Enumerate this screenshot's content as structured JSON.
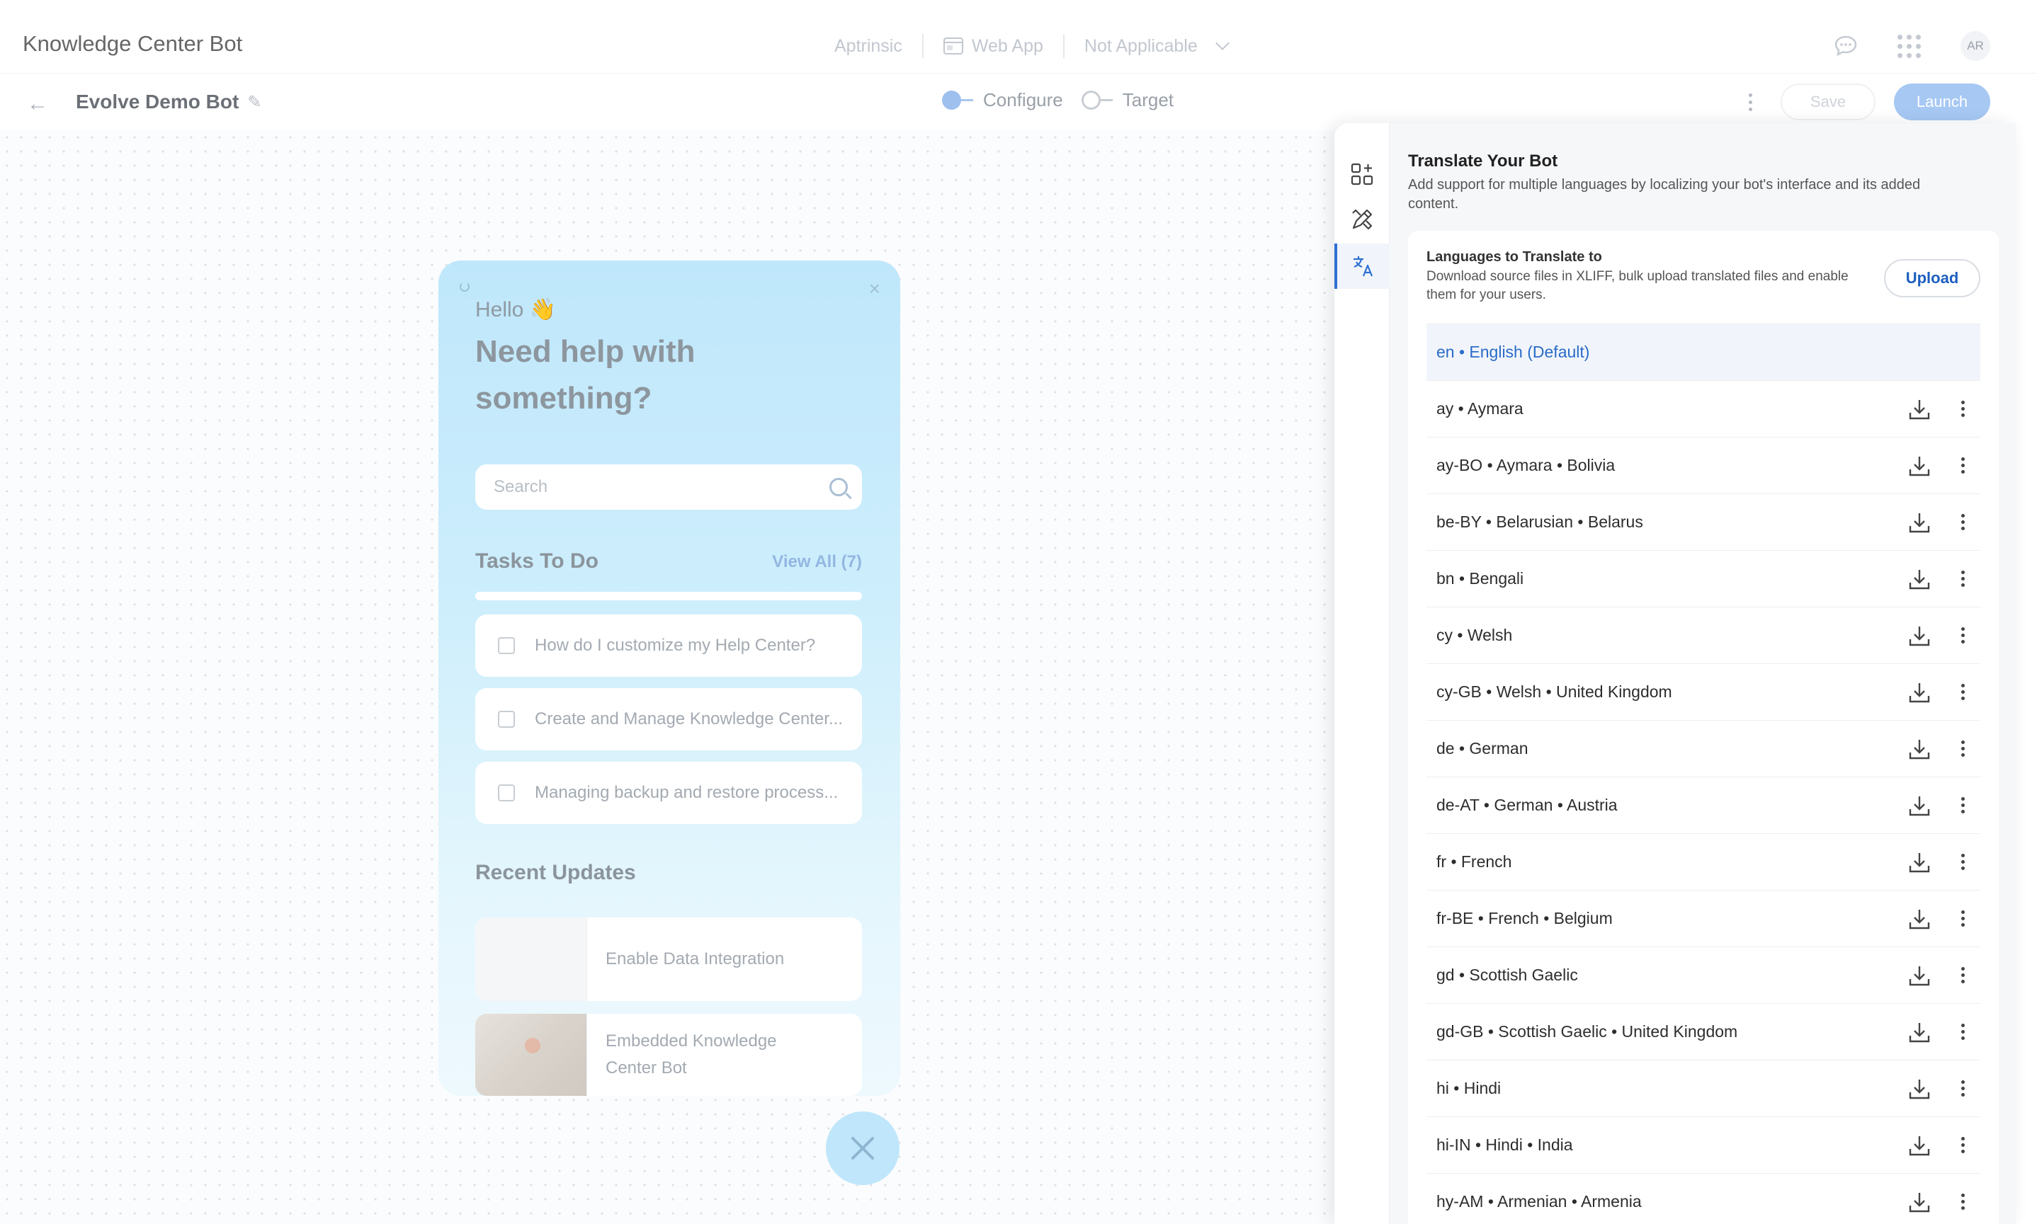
{
  "header": {
    "app_title": "Knowledge Center Bot",
    "product": "Aptrinsic",
    "channel": "Web App",
    "environment": "Not Applicable",
    "avatar_initials": "AR"
  },
  "subbar": {
    "bot_name": "Evolve Demo Bot",
    "steps": [
      "Configure",
      "Target"
    ],
    "save_label": "Save",
    "launch_label": "Launch"
  },
  "widget": {
    "greeting": "Hello 👋",
    "headline": "Need help with something?",
    "search_placeholder": "Search",
    "tasks_title": "Tasks To Do",
    "view_all": "View All (7)",
    "tasks": [
      "How do I customize my Help Center?",
      "Create and Manage Knowledge Center...",
      "Managing backup and restore process..."
    ],
    "recent_title": "Recent Updates",
    "updates": [
      "Enable Data Integration",
      "Embedded Knowledge Center Bot"
    ]
  },
  "panel": {
    "title": "Translate Your Bot",
    "description": "Add support for multiple languages by localizing your bot's interface and its added content.",
    "card_title": "Languages to Translate to",
    "card_description": "Download source files in XLIFF, bulk upload translated files and enable them for your users.",
    "upload_label": "Upload",
    "default_language": "en • English (Default)",
    "languages": [
      "ay • Aymara",
      "ay-BO • Aymara • Bolivia",
      "be-BY • Belarusian • Belarus",
      "bn • Bengali",
      "cy • Welsh",
      "cy-GB • Welsh • United Kingdom",
      "de • German",
      "de-AT • German • Austria",
      "fr • French",
      "fr-BE • French • Belgium",
      "gd • Scottish Gaelic",
      "gd-GB • Scottish Gaelic • United Kingdom",
      "hi • Hindi",
      "hi-IN • Hindi • India",
      "hy-AM • Armenian • Armenia"
    ]
  },
  "colors": {
    "accent": "#2e6fd1",
    "launch": "#a6c8f3",
    "widget_bg": "#bfe7fb"
  }
}
